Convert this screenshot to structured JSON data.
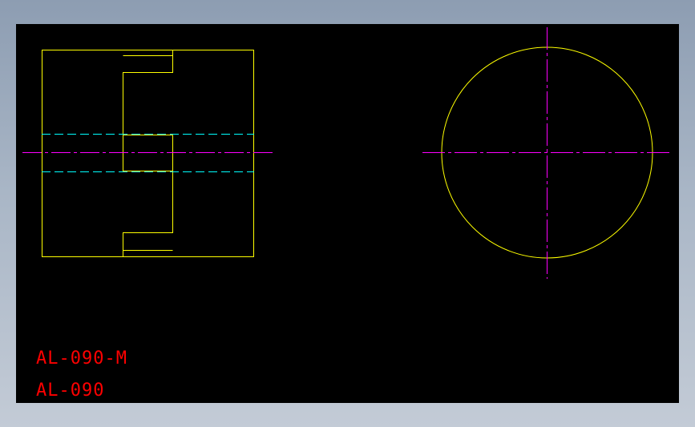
{
  "drawing": {
    "labels": [
      "AL-090-M",
      "AL-090"
    ],
    "colors": {
      "outline": "#ffff00",
      "centerline": "#ff00ff",
      "hidden": "#00ffff",
      "text": "#ff0000",
      "background": "#000000"
    }
  }
}
